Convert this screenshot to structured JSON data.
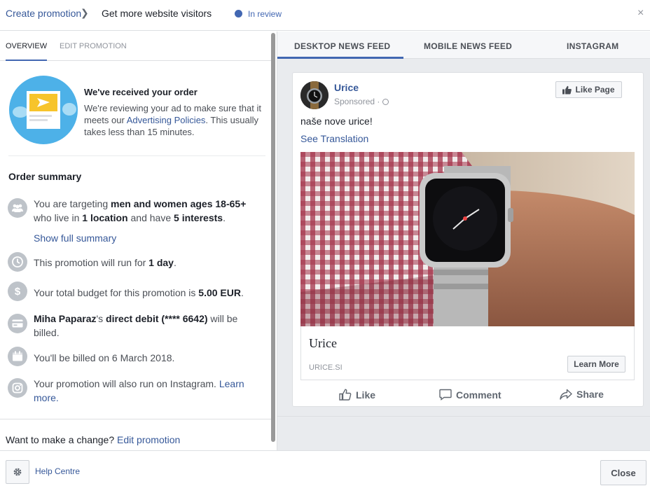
{
  "header": {
    "breadcrumb_root": "Create promotion",
    "breadcrumb_sep": "❯",
    "breadcrumb_current": "Get more website visitors",
    "status": "In review",
    "close_glyph": "×"
  },
  "left": {
    "tabs": [
      {
        "label": "OVERVIEW",
        "active": true
      },
      {
        "label": "EDIT PROMOTION",
        "active": false
      }
    ],
    "received": {
      "title": "We've received your order",
      "body_prefix": "We're reviewing your ad to make sure that it meets our ",
      "body_link": "Advertising Policies",
      "body_suffix": ". This usually takes less than 15 minutes."
    },
    "summary": {
      "title": "Order summary",
      "targeting": {
        "t1": "You are targeting ",
        "b1": "men and women ages 18-65+",
        "t2": " who live in ",
        "b2": "1 location",
        "t3": " and have ",
        "b3": "5 interests",
        "t4": "."
      },
      "show_full": "Show full summary",
      "duration": {
        "t1": "This promotion will run for ",
        "b1": "1 day",
        "t2": "."
      },
      "budget": {
        "t1": "Your total budget for this promotion is ",
        "b1": "5.00 EUR",
        "t2": "."
      },
      "billing": {
        "b1": "Miha Paparaz",
        "t1": "'s ",
        "b2": "direct debit (**** 6642)",
        "t2": " will be billed."
      },
      "billed_on": "You'll be billed on 6 March 2018.",
      "instagram": {
        "t1": "Your promotion will also run on Instagram. ",
        "link": "Learn more."
      }
    },
    "change": {
      "text": "Want to make a change? ",
      "link": "Edit promotion"
    }
  },
  "right": {
    "tabs": [
      {
        "label": "DESKTOP NEWS FEED",
        "active": true
      },
      {
        "label": "MOBILE NEWS FEED",
        "active": false
      },
      {
        "label": "INSTAGRAM",
        "active": false
      }
    ],
    "post": {
      "page_name": "Urice",
      "sponsored": "Sponsored · ",
      "like_page": "Like Page",
      "text": "naše nove urice!",
      "see_translation": "See Translation",
      "link_title": "Urice",
      "link_domain": "URICE.SI",
      "cta": "Learn More",
      "actions": [
        "Like",
        "Comment",
        "Share"
      ]
    }
  },
  "footer": {
    "help": "Help Centre",
    "close": "Close"
  },
  "colors": {
    "link": "#365899",
    "accent": "#4267b2",
    "muted": "#90949c",
    "border": "#dddfe2"
  }
}
